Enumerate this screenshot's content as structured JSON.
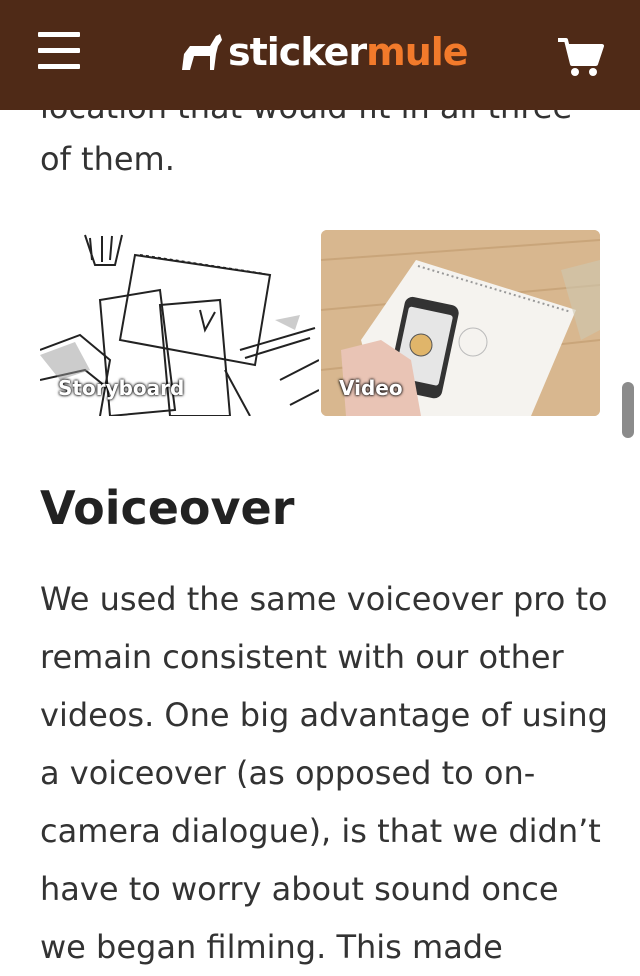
{
  "header": {
    "menu_icon": "hamburger-menu-icon",
    "logo": {
      "part1": "sticker",
      "part2": "mule",
      "icon": "mule-logo-icon"
    },
    "cart_icon": "shopping-cart-icon",
    "colors": {
      "background": "#4f2a17",
      "accent": "#f27a2b"
    }
  },
  "article": {
    "partial_line": "location that would fit in all three",
    "paragraph_end": "of them.",
    "media": [
      {
        "label": "Storyboard"
      },
      {
        "label": "Video"
      }
    ],
    "section_title": "Voiceover",
    "body": "We used the same voiceover pro to remain consistent with our other videos. One big advantage of using a voiceover (as opposed to on-camera dialogue), is that we didn’t have to worry about sound once we began filming. This made"
  }
}
